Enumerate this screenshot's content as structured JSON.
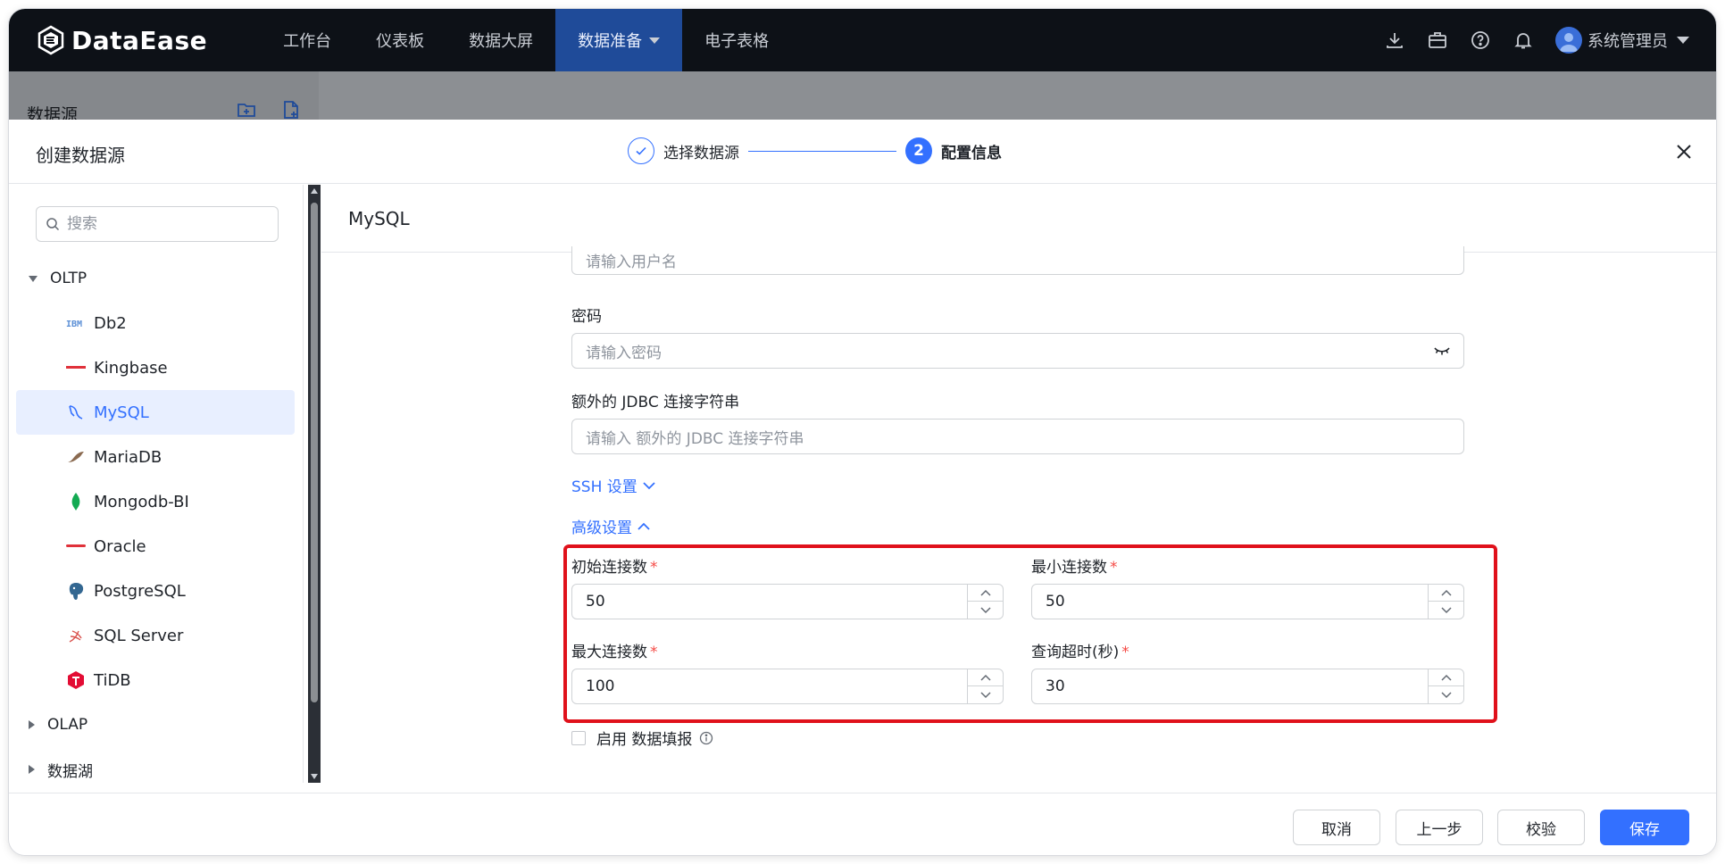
{
  "app": {
    "brand": "DataEase"
  },
  "nav": {
    "items": [
      {
        "label": "工作台"
      },
      {
        "label": "仪表板"
      },
      {
        "label": "数据大屏"
      },
      {
        "label": "数据准备",
        "active": true
      },
      {
        "label": "电子表格"
      }
    ],
    "user": "系统管理员"
  },
  "background": {
    "panel_title": "数据源"
  },
  "dialog": {
    "title": "创建数据源",
    "steps": [
      {
        "label": "选择数据源",
        "status": "done"
      },
      {
        "label": "配置信息",
        "number": "2",
        "status": "active"
      }
    ]
  },
  "left": {
    "search_placeholder": "搜索",
    "groups": [
      {
        "label": "OLTP",
        "expanded": true,
        "items": [
          {
            "label": "Db2",
            "icon": "ibm-icon"
          },
          {
            "label": "Kingbase",
            "icon": "kingbase-icon"
          },
          {
            "label": "MySQL",
            "icon": "mysql-icon",
            "active": true
          },
          {
            "label": "MariaDB",
            "icon": "mariadb-icon"
          },
          {
            "label": "Mongodb-BI",
            "icon": "mongodb-icon"
          },
          {
            "label": "Oracle",
            "icon": "oracle-icon"
          },
          {
            "label": "PostgreSQL",
            "icon": "postgresql-icon"
          },
          {
            "label": "SQL Server",
            "icon": "sqlserver-icon"
          },
          {
            "label": "TiDB",
            "icon": "tidb-icon"
          }
        ]
      },
      {
        "label": "OLAP",
        "expanded": false
      },
      {
        "label": "数据湖",
        "expanded": false
      }
    ]
  },
  "right": {
    "title": "MySQL",
    "username_placeholder": "请输入用户名",
    "password_label": "密码",
    "password_placeholder": "请输入密码",
    "jdbc_label": "额外的 JDBC 连接字符串",
    "jdbc_placeholder": "请输入 额外的 JDBC 连接字符串",
    "ssh_label": "SSH 设置",
    "advanced_label": "高级设置",
    "initial_conn_label": "初始连接数",
    "initial_conn_value": "50",
    "min_conn_label": "最小连接数",
    "min_conn_value": "50",
    "max_conn_label": "最大连接数",
    "max_conn_value": "100",
    "query_timeout_label": "查询超时(秒)",
    "query_timeout_value": "30",
    "required_mark": "*",
    "enable_fill_label": "启用 数据填报"
  },
  "footer": {
    "cancel": "取消",
    "prev": "上一步",
    "validate": "校验",
    "save": "保存"
  },
  "colors": {
    "accent": "#3370ff",
    "highlight": "#e0111b",
    "nav_bg": "#0d1117"
  }
}
